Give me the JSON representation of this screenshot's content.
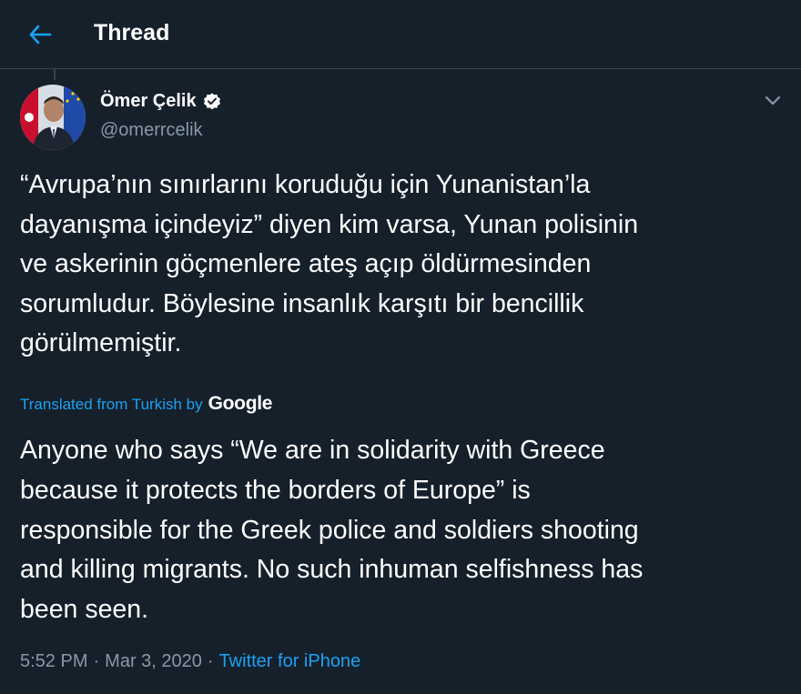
{
  "header": {
    "title": "Thread",
    "back_icon": "arrow-left-icon",
    "accent_color": "#1da1f2"
  },
  "tweet": {
    "author_name": "Ömer Çelik",
    "verified_icon": "verified-badge-icon",
    "handle": "@omerrcelik",
    "menu_icon": "chevron-down-icon",
    "text_lines": [
      "“Avrupa’nın sınırlarını koruduğu için Yunanistan’la",
      "dayanışma içindeyiz” diyen kim varsa, Yunan polisinin",
      "ve askerinin göçmenlere ateş açıp öldürmesinden",
      "sorumludur. Böylesine insanlık karşıtı bir bencillik",
      "görülmemiştir."
    ],
    "translated_label": "Translated from Turkish by",
    "translator": "Google",
    "translation_lines": [
      "Anyone who says “We are in solidarity with Greece",
      "because it protects the borders of Europe” is",
      "responsible for the Greek police and soldiers shooting",
      "and killing migrants. No such inhuman selfishness has",
      "been seen."
    ],
    "time": "5:52 PM",
    "separator": "·",
    "date": "Mar 3, 2020",
    "source": "Twitter for iPhone"
  },
  "colors": {
    "background": "#15202b",
    "secondary_text": "#8899a6",
    "border": "#38444d"
  }
}
